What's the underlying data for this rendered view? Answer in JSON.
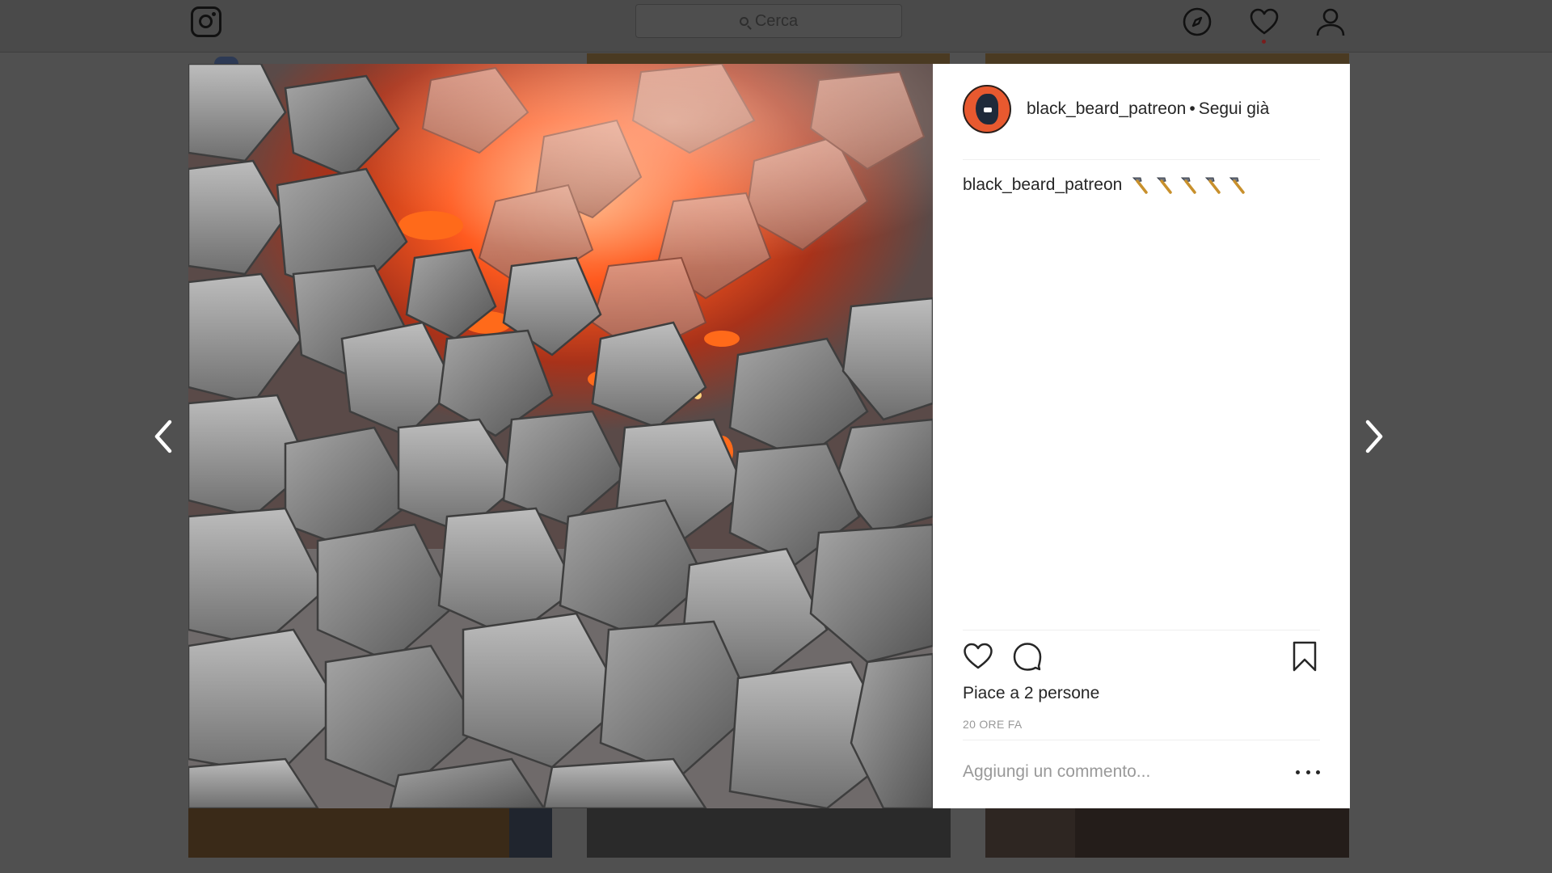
{
  "topbar": {
    "logo_icon": "instagram-logo-icon",
    "search_placeholder": "Cerca",
    "icons": [
      "compass-icon",
      "heart-icon",
      "profile-icon"
    ]
  },
  "post": {
    "image_alt": "Carbone incandescente nella forgia",
    "username": "black_beard_patreon",
    "separator": "•",
    "follow_status": "Segui già",
    "caption_user": "black_beard_patreon",
    "caption_icons": [
      "hammer-icon",
      "hammer-icon",
      "hammer-icon",
      "hammer-icon",
      "hammer-icon"
    ],
    "likes_text": "Piace a 2 persone",
    "time_ago": "20 ORE FA",
    "comment_placeholder": "Aggiungi un commento..."
  },
  "colors": {
    "overlay_background": "#505050",
    "panel_background": "#ffffff",
    "text_primary": "#262626",
    "text_secondary": "#999999",
    "avatar_accent": "#e8592f",
    "ember": "#ff5a1f"
  }
}
